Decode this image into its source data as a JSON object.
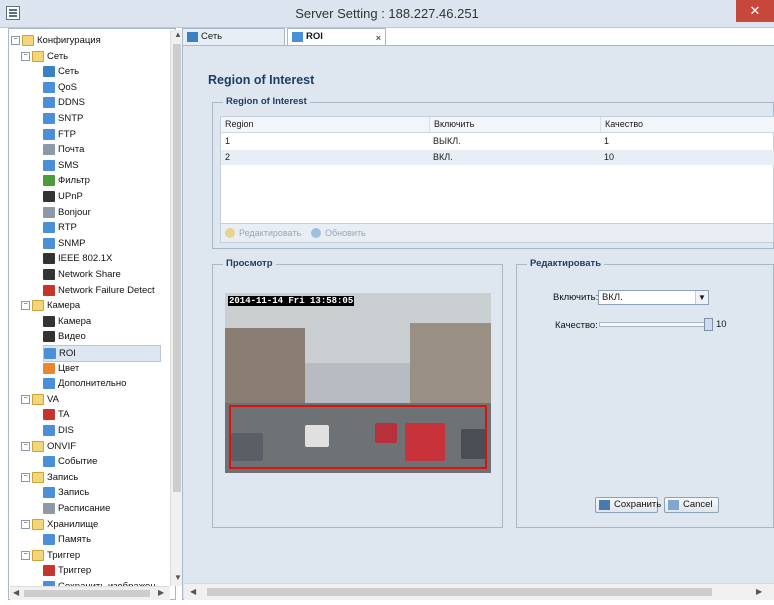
{
  "window": {
    "title": "Server Setting : 188.227.46.251",
    "close_glyph": "✕"
  },
  "tree": [
    {
      "label": "Конфигурация",
      "level": 0,
      "expander": "−",
      "icon": "folder-icon"
    },
    {
      "label": "Сеть",
      "level": 1,
      "expander": "−",
      "icon": "folder-icon"
    },
    {
      "label": "Сеть",
      "level": 2,
      "icon": "network-icon"
    },
    {
      "label": "QoS",
      "level": 2,
      "icon": "qos-icon"
    },
    {
      "label": "DDNS",
      "level": 2,
      "icon": "ddns-icon"
    },
    {
      "label": "SNTP",
      "level": 2,
      "icon": "sntp-icon"
    },
    {
      "label": "FTP",
      "level": 2,
      "icon": "ftp-icon"
    },
    {
      "label": "Почта",
      "level": 2,
      "icon": "mail-icon"
    },
    {
      "label": "SMS",
      "level": 2,
      "icon": "sms-icon"
    },
    {
      "label": "Фильтр",
      "level": 2,
      "icon": "filter-icon"
    },
    {
      "label": "UPnP",
      "level": 2,
      "icon": "upnp-icon"
    },
    {
      "label": "Bonjour",
      "level": 2,
      "icon": "bonjour-icon"
    },
    {
      "label": "RTP",
      "level": 2,
      "icon": "rtp-icon"
    },
    {
      "label": "SNMP",
      "level": 2,
      "icon": "snmp-icon"
    },
    {
      "label": "IEEE 802.1X",
      "level": 2,
      "icon": "ieee-icon"
    },
    {
      "label": "Network Share",
      "level": 2,
      "icon": "network-share-icon"
    },
    {
      "label": "Network Failure Detect",
      "level": 2,
      "icon": "network-failure-icon"
    },
    {
      "label": "Камера",
      "level": 1,
      "expander": "−",
      "icon": "folder-icon"
    },
    {
      "label": "Камера",
      "level": 2,
      "icon": "camera-icon"
    },
    {
      "label": "Видео",
      "level": 2,
      "icon": "video-icon"
    },
    {
      "label": "ROI",
      "level": 2,
      "icon": "roi-icon",
      "selected": true
    },
    {
      "label": "Цвет",
      "level": 2,
      "icon": "color-icon"
    },
    {
      "label": "Дополнительно",
      "level": 2,
      "icon": "advanced-icon"
    },
    {
      "label": "VA",
      "level": 1,
      "expander": "−",
      "icon": "folder-icon"
    },
    {
      "label": "TA",
      "level": 2,
      "icon": "ta-icon"
    },
    {
      "label": "DIS",
      "level": 2,
      "icon": "dis-icon"
    },
    {
      "label": "ONVIF",
      "level": 1,
      "expander": "−",
      "icon": "folder-icon"
    },
    {
      "label": "Событие",
      "level": 2,
      "icon": "event-icon"
    },
    {
      "label": "Запись",
      "level": 1,
      "expander": "−",
      "icon": "folder-icon"
    },
    {
      "label": "Запись",
      "level": 2,
      "icon": "record-icon"
    },
    {
      "label": "Расписание",
      "level": 2,
      "icon": "schedule-icon"
    },
    {
      "label": "Хранилище",
      "level": 1,
      "expander": "−",
      "icon": "folder-icon"
    },
    {
      "label": "Память",
      "level": 2,
      "icon": "memory-icon"
    },
    {
      "label": "Триггер",
      "level": 1,
      "expander": "−",
      "icon": "folder-icon"
    },
    {
      "label": "Триггер",
      "level": 2,
      "icon": "trigger-icon"
    },
    {
      "label": "Сохранить изображен",
      "level": 2,
      "icon": "save-image-icon"
    }
  ],
  "tabs": [
    {
      "label": "Сеть",
      "icon": "network-icon",
      "active": false
    },
    {
      "label": "ROI",
      "icon": "roi-icon",
      "active": true,
      "close": "×"
    }
  ],
  "page_title": "Region of Interest",
  "roi_group": {
    "title": "Region of Interest",
    "columns": [
      "Region",
      "Включить",
      "Качество"
    ],
    "rows": [
      [
        "1",
        "ВЫКЛ.",
        "1"
      ],
      [
        "2",
        "ВКЛ.",
        "10"
      ]
    ],
    "toolbar": {
      "edit_label": "Редактировать",
      "refresh_label": "Обновить"
    }
  },
  "preview_group": {
    "title": "Просмотр",
    "timestamp": "2014-11-14 Fri 13:58:05"
  },
  "edit_group": {
    "title": "Редактировать",
    "enable_label": "Включить:",
    "enable_value": "ВКЛ.",
    "quality_label": "Качество:",
    "quality_value": "10",
    "quality_level": 1.0,
    "save_label": "Сохранить",
    "cancel_label": "Cancel"
  },
  "colors": {
    "accent": "#1f3d63",
    "panel": "#dee6f0",
    "roi": "#e01010"
  }
}
